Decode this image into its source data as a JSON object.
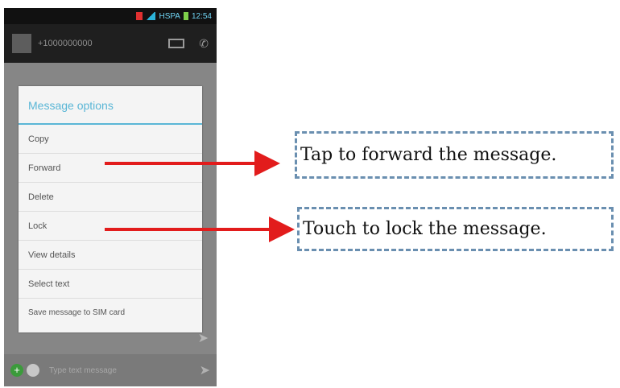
{
  "phone": {
    "status_time": "12:54",
    "status_net": "HSPA",
    "contact_number": "+1000000000",
    "dialog": {
      "title": "Message options",
      "items": [
        {
          "label": "Copy"
        },
        {
          "label": "Forward"
        },
        {
          "label": "Delete"
        },
        {
          "label": "Lock"
        },
        {
          "label": "View details"
        },
        {
          "label": "Select text"
        },
        {
          "label": "Save message to SIM card"
        }
      ]
    },
    "compose_placeholder": "Type text message"
  },
  "callouts": {
    "forward": "Tap to forward the message.",
    "lock": "Touch to lock the message."
  },
  "colors": {
    "accent": "#5ab6d6",
    "arrow": "#e21c1c",
    "dash_border": "#6a8fb0"
  }
}
